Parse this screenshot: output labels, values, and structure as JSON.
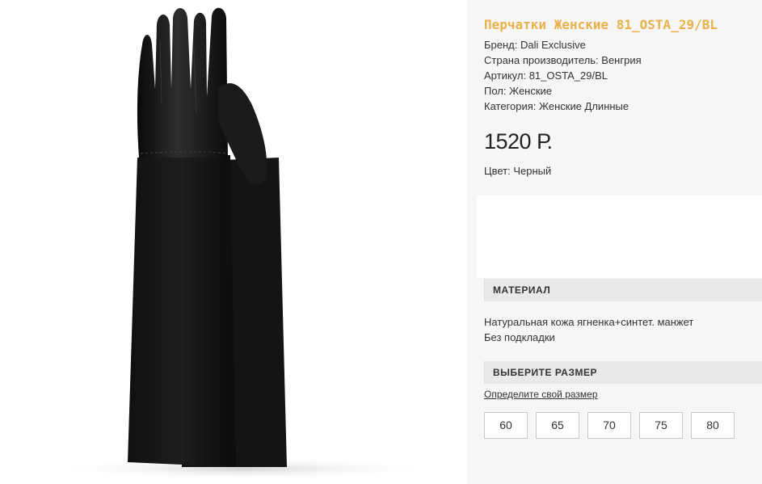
{
  "product": {
    "title": "Перчатки Женские 81_OSTA_29/BL",
    "brand": "Бренд: Dali Exclusive",
    "country": "Страна производитель: Венгрия",
    "sku": "Артикул: 81_OSTA_29/BL",
    "gender": "Пол: Женские",
    "category": "Категория: Женские Длинные",
    "price": "1520 Р.",
    "color": "Цвет: Черный"
  },
  "material": {
    "header": "МАТЕРИАЛ",
    "line1": "Натуральная кожа ягненка+синтет. манжет",
    "line2": "Без подкладки"
  },
  "size": {
    "header": "ВЫБЕРИТЕ РАЗМЕР",
    "link": "Определите свой размер",
    "options": [
      "60",
      "65",
      "70",
      "75",
      "80"
    ]
  },
  "colors": {
    "title": "#e8b14a",
    "panel_bg": "#f6f6f6",
    "header_bg": "#e9e9e9"
  },
  "image": {
    "subject": "black long leather-knit women's gloves"
  }
}
